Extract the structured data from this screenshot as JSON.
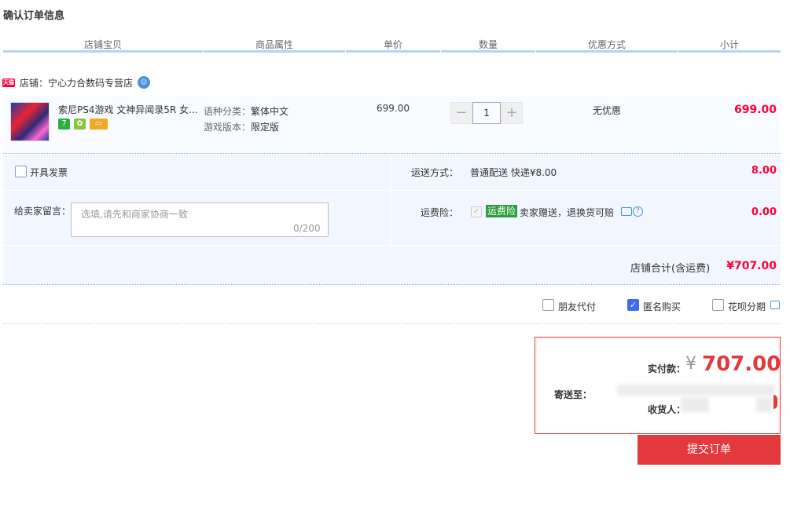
{
  "page": {
    "title": "确认订单信息"
  },
  "columns": [
    "店铺宝贝",
    "商品属性",
    "单价",
    "数量",
    "优惠方式",
    "小计"
  ],
  "shop": {
    "badge": "天猫",
    "label": "店铺：宁心力合数码专营店"
  },
  "item": {
    "title": "索尼PS4游戏 文神异闻录5R 女...",
    "props": [
      {
        "key": "语种分类：",
        "value": "繁体中文"
      },
      {
        "key": "游戏版本：",
        "value": "限定版"
      }
    ],
    "tags": [
      {
        "icon": "seven-day-return-icon",
        "text": "7",
        "color": "#2fae45"
      },
      {
        "icon": "guarantee-icon",
        "text": "",
        "color": "#8ac33e"
      },
      {
        "icon": "credit-card-icon",
        "text": "",
        "color": "#f5a623"
      }
    ],
    "unit_price": "699.00",
    "quantity": "1",
    "discount": "无优惠",
    "subtotal": "699.00"
  },
  "invoice": {
    "label": "开具发票"
  },
  "shipping": {
    "label": "运送方式：",
    "value": "普通配送 快递¥8.00",
    "amount": "8.00"
  },
  "memo": {
    "label": "给卖家留言：",
    "placeholder": "选填,请先和商家协商一致",
    "count": "0/200"
  },
  "insurance": {
    "label": "运费险：",
    "tag": "运费险",
    "desc": "卖家赠送，退换货可赔",
    "amount": "0.00"
  },
  "shop_total": {
    "label": "店铺合计(含运费)",
    "value": "¥707.00"
  },
  "options": [
    {
      "label": "朋友代付",
      "checked": false
    },
    {
      "label": "匿名购买",
      "checked": true
    },
    {
      "label": "花呗分期",
      "checked": false
    }
  ],
  "payment": {
    "paid_label": "实付款：",
    "currency": "¥",
    "amount": "707.00",
    "ship_to_label": "寄送至：",
    "receiver_label": "收货人："
  },
  "submit": {
    "label": "提交订单"
  }
}
